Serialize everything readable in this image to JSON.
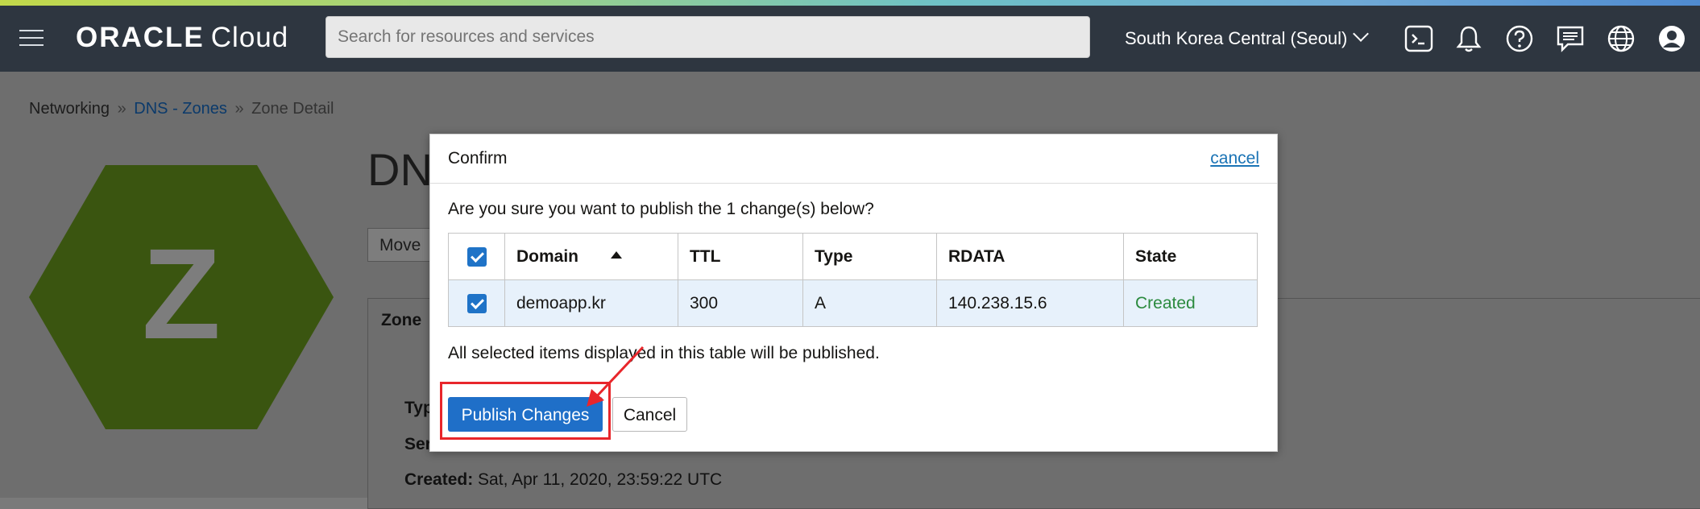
{
  "header": {
    "logo_brand": "ORACLE",
    "logo_product": "Cloud",
    "search_placeholder": "Search for resources and services",
    "region": "South Korea Central (Seoul)",
    "icons": [
      "menu-icon",
      "cloud-shell-icon",
      "bell-icon",
      "help-icon",
      "chat-icon",
      "globe-icon",
      "user-icon"
    ]
  },
  "breadcrumb": {
    "items": [
      "Networking",
      "DNS - Zones",
      "Zone Detail"
    ],
    "separator": "»"
  },
  "background_page": {
    "avatar_letter": "Z",
    "title": "DNS",
    "move_button": "Move",
    "zone_tab": "Zone",
    "field_type": "Typ",
    "field_serial": "Ser",
    "created_label": "Created:",
    "created_value": "Sat, Apr 11, 2020, 23:59:22 UTC"
  },
  "modal": {
    "title": "Confirm",
    "cancel_link": "cancel",
    "question": "Are you sure you want to publish the 1 change(s) below?",
    "table": {
      "columns": [
        "Domain",
        "TTL",
        "Type",
        "RDATA",
        "State"
      ],
      "rows": [
        {
          "domain": "demoapp.kr",
          "ttl": "300",
          "type": "A",
          "rdata": "140.238.15.6",
          "state": "Created",
          "checked": true
        }
      ]
    },
    "note": "All selected items displayed in this table will be published.",
    "publish_button": "Publish Changes",
    "cancel_button": "Cancel"
  },
  "colors": {
    "topbar": "#2e3640",
    "primary_button": "#1f6fc8",
    "state_created": "#2b8a3e",
    "highlight": "#e8262b",
    "avatar_hex": "#5f8a1c"
  }
}
